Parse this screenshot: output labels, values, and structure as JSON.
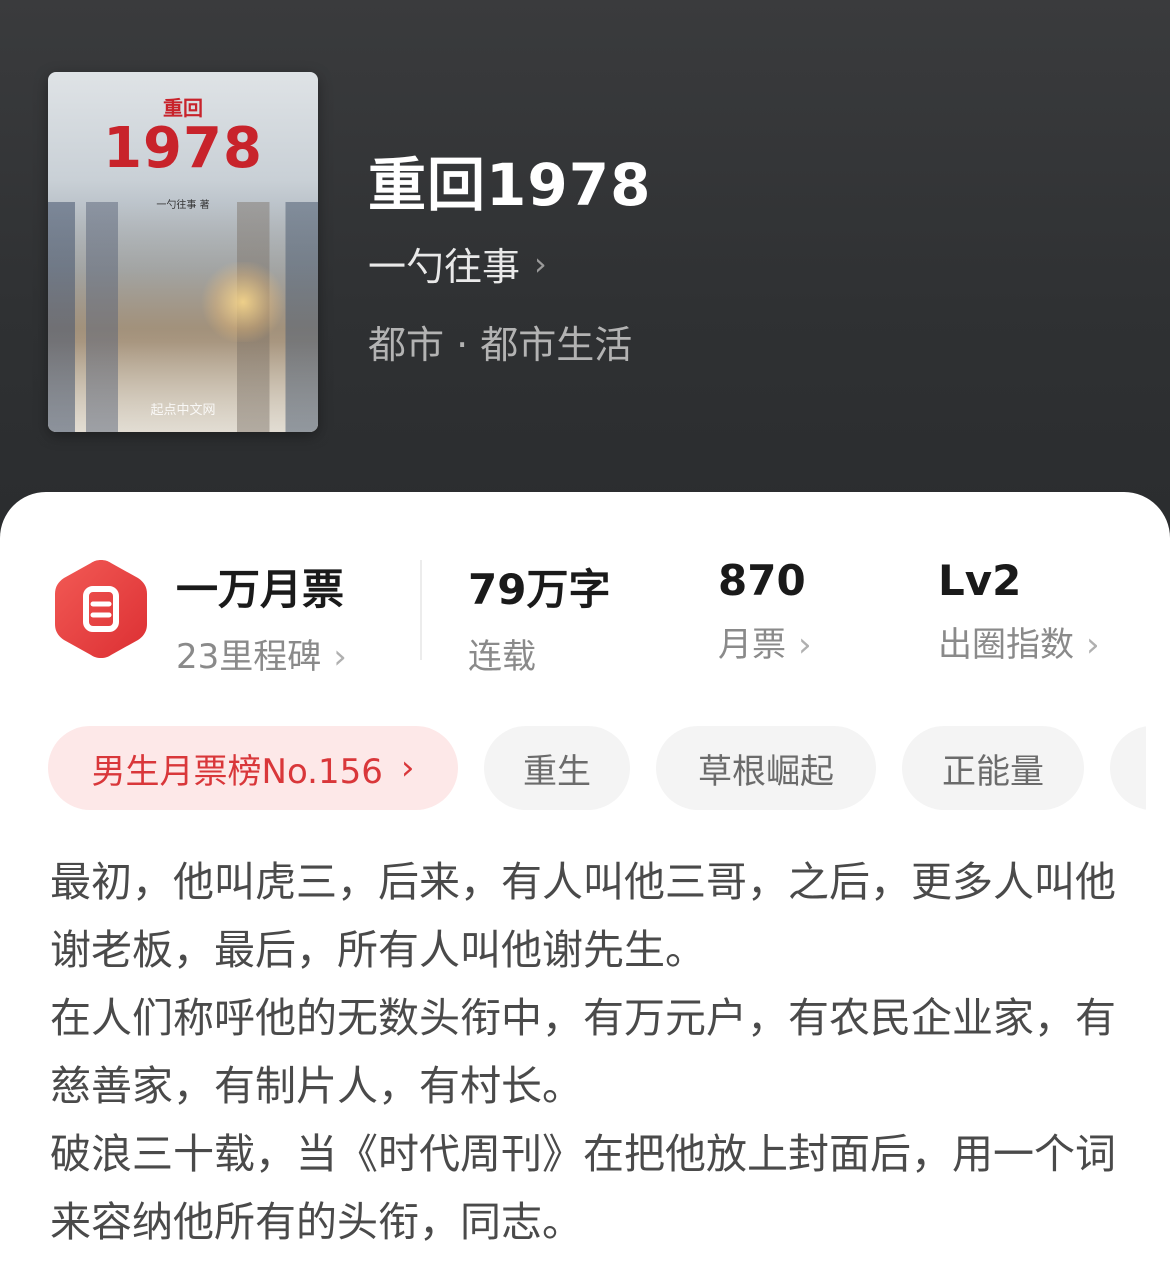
{
  "book": {
    "cover": {
      "subtitle": "重回",
      "title": "1978",
      "author": "一勺往事 著",
      "brand": "起点中文网"
    },
    "title": "重回1978",
    "author": "一勺往事",
    "genre": "都市 · 都市生活"
  },
  "stats": {
    "tickets": {
      "title": "一万月票",
      "sub": "23里程碑"
    },
    "words": {
      "value": "79万字",
      "label": "连载"
    },
    "monthly": {
      "value": "870",
      "label": "月票"
    },
    "level": {
      "value": "Lv2",
      "label": "出圈指数"
    }
  },
  "tags": [
    "男生月票榜No.156",
    "重生",
    "草根崛起",
    "正能量"
  ],
  "description": [
    "最初，他叫虎三，后来，有人叫他三哥，之后，更多人叫他谢老板，最后，所有人叫他谢先生。",
    "在人们称呼他的无数头衔中，有万元户，有农民企业家，有慈善家，有制片人，有村长。",
    "破浪三十载，当《时代周刊》在把他放上封面后，用一个词来容纳他所有的头衔，同志。"
  ],
  "icons": {
    "chevron": "›",
    "badge": "ticket-hexagon-icon"
  },
  "colors": {
    "accent": "#e5393d",
    "tag_rank_bg": "#fde8e8"
  }
}
